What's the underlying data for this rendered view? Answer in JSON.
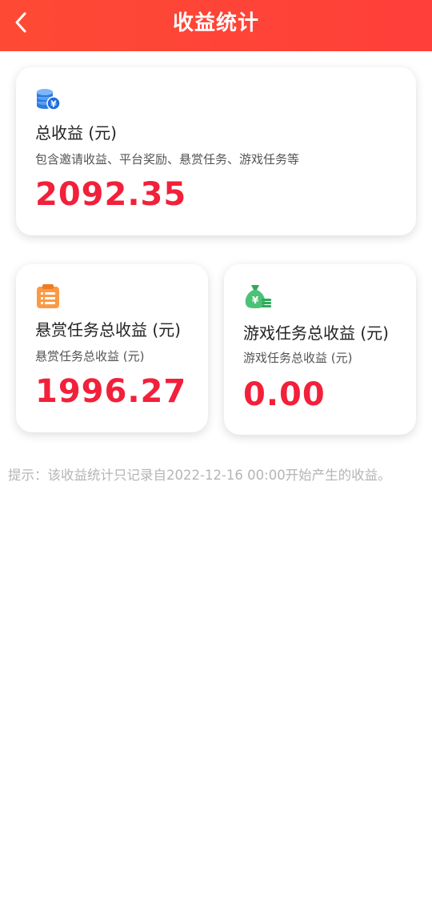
{
  "header": {
    "title": "收益统计",
    "back_icon": "chevron-left-icon"
  },
  "total": {
    "icon": "coins-icon",
    "title": "总收益 (元)",
    "desc": "包含邀请收益、平台奖励、悬赏任务、游戏任务等",
    "value": "2092.35"
  },
  "reward": {
    "icon": "clipboard-list-icon",
    "title": "悬赏任务总收益 (元)",
    "desc": "悬赏任务总收益 (元)",
    "value": "1996.27"
  },
  "game": {
    "icon": "money-bag-icon",
    "title": "游戏任务总收益 (元)",
    "desc": "游戏任务总收益 (元)",
    "value": "0.00"
  },
  "hint": "提示：该收益统计只记录自2022-12-16 00:00开始产生的收益。",
  "colors": {
    "header_start": "#fe4a34",
    "header_end": "#ff3f3a",
    "value_red": "#f2203a",
    "hint_gray": "#b5b5b5"
  }
}
